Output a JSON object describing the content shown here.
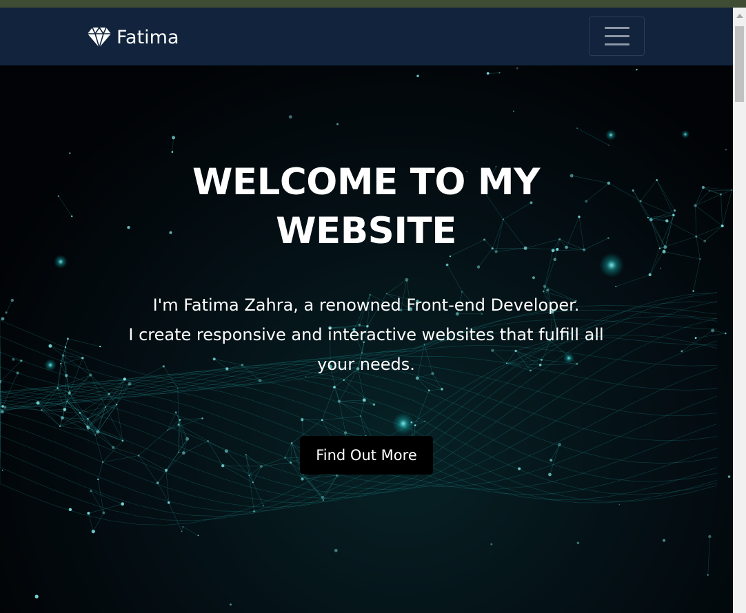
{
  "navbar": {
    "brand_name": "Fatima",
    "brand_icon": "gem-icon",
    "toggler_icon": "hamburger-menu-icon"
  },
  "hero": {
    "title": "WELCOME TO MY WEBSITE",
    "lines": [
      "I'm Fatima Zahra, a renowned Front-end Developer.",
      "I create responsive and interactive websites that fulfill all your needs."
    ],
    "cta_label": "Find Out More"
  },
  "colors": {
    "navbar_bg": "#12243d",
    "hero_bg": "#02060a",
    "accent_teal": "#2fd6d6",
    "button_bg": "#000000",
    "text": "#ffffff"
  }
}
